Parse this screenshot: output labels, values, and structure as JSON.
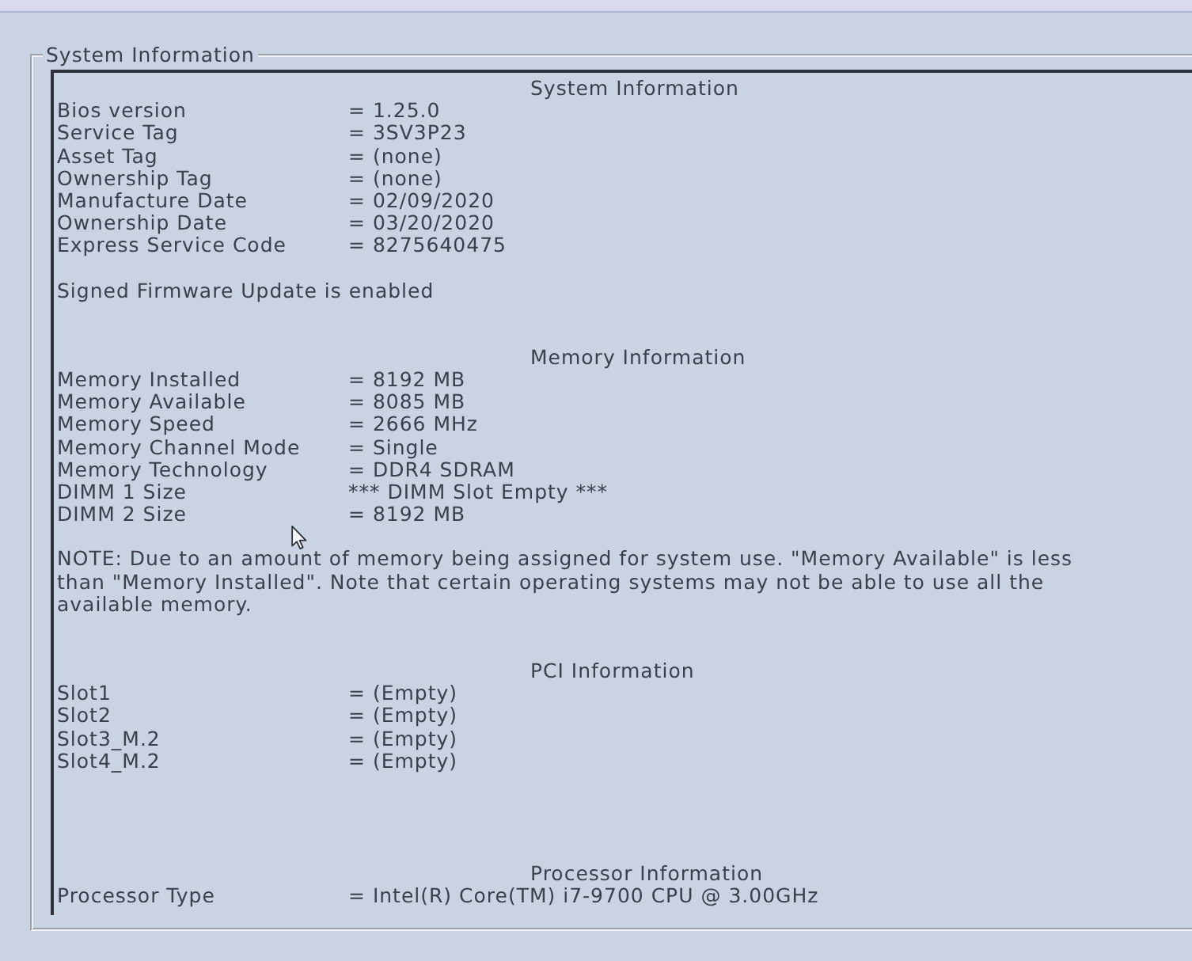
{
  "group": {
    "title": "System Information"
  },
  "sections": [
    {
      "heading": "System Information",
      "rows": [
        {
          "label": "Bios version",
          "value": "= 1.25.0"
        },
        {
          "label": "Service Tag",
          "value": "= 3SV3P23"
        },
        {
          "label": "Asset Tag",
          "value": "= (none)"
        },
        {
          "label": "Ownership Tag",
          "value": "= (none)"
        },
        {
          "label": "Manufacture Date",
          "value": "= 02/09/2020"
        },
        {
          "label": "Ownership Date",
          "value": "= 03/20/2020"
        },
        {
          "label": "Express Service Code",
          "value": "= 8275640475"
        }
      ],
      "note": "Signed Firmware Update is enabled"
    },
    {
      "heading": "Memory Information",
      "rows": [
        {
          "label": "Memory Installed",
          "value": "= 8192 MB"
        },
        {
          "label": "Memory Available",
          "value": "= 8085 MB"
        },
        {
          "label": "Memory Speed",
          "value": "= 2666 MHz"
        },
        {
          "label": "Memory Channel Mode",
          "value": "= Single"
        },
        {
          "label": "Memory Technology",
          "value": "= DDR4 SDRAM"
        },
        {
          "label": "DIMM 1 Size",
          "value": "*** DIMM Slot Empty ***"
        },
        {
          "label": "DIMM 2 Size",
          "value": "= 8192 MB"
        }
      ],
      "note": "NOTE: Due to an amount of memory being assigned for system use. \"Memory Available\" is less than \"Memory Installed\". Note that certain operating systems may not be able to use all the available memory."
    },
    {
      "heading": "PCI Information",
      "rows": [
        {
          "label": "Slot1",
          "value": "= (Empty)"
        },
        {
          "label": "Slot2",
          "value": "= (Empty)"
        },
        {
          "label": "Slot3_M.2",
          "value": "= (Empty)"
        },
        {
          "label": "Slot4_M.2",
          "value": "= (Empty)"
        }
      ]
    },
    {
      "heading": "Processor Information",
      "rows": [
        {
          "label": "Processor Type",
          "value": "= Intel(R) Core(TM) i7-9700 CPU @ 3.00GHz"
        }
      ]
    }
  ]
}
